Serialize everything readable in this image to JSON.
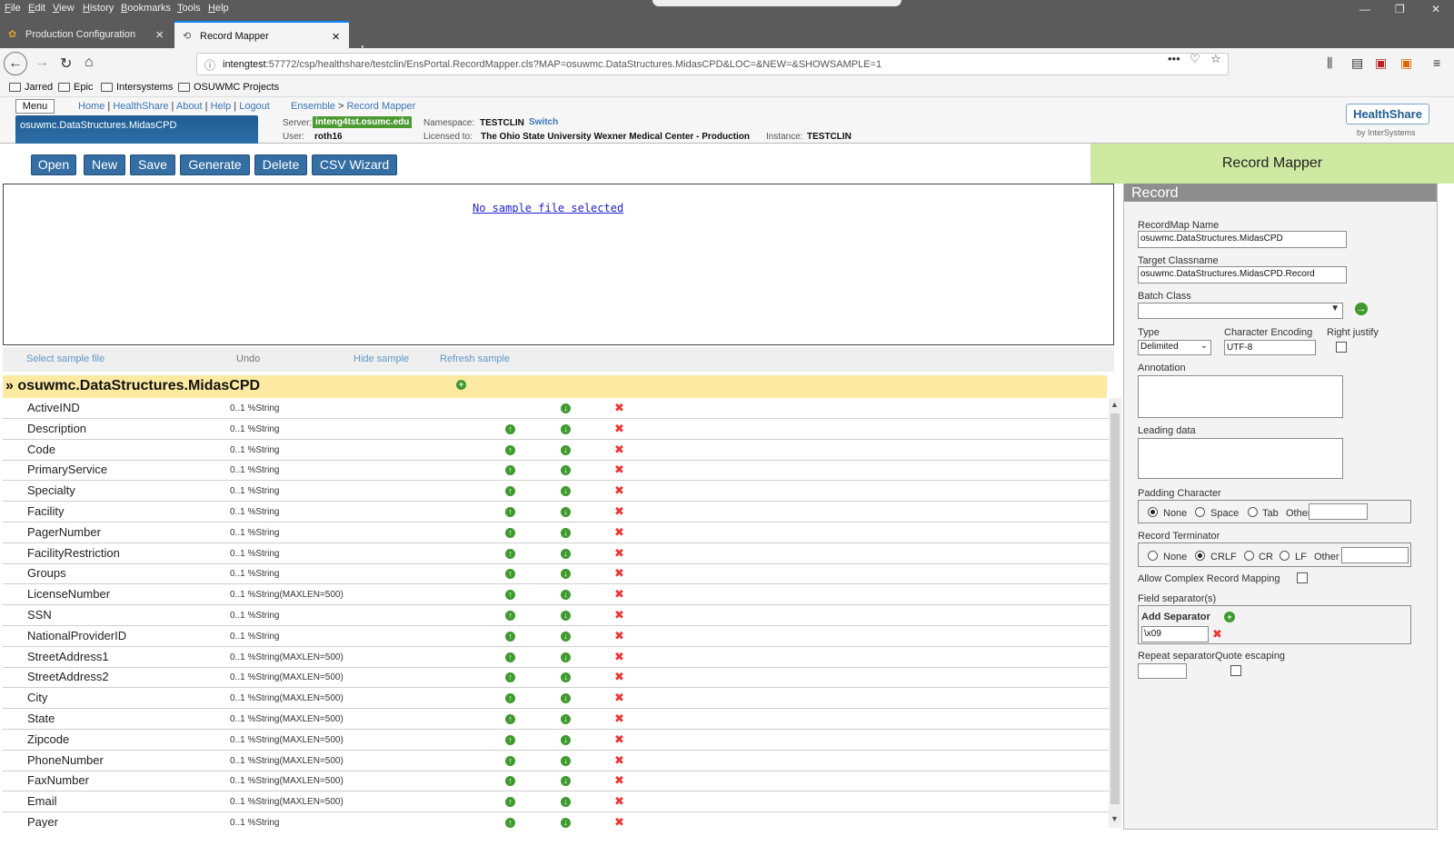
{
  "browser": {
    "menu": [
      "File",
      "Edit",
      "View",
      "History",
      "Bookmarks",
      "Tools",
      "Help"
    ],
    "tabs": [
      {
        "label": "Production Configuration"
      },
      {
        "label": "Record Mapper"
      }
    ],
    "url_host": "intengtest",
    "url_rest": ":57772/csp/healthshare/testclin/EnsPortal.RecordMapper.cls?MAP=osuwmc.DataStructures.MidasCPD&LOC=&NEW=&SHOWSAMPLE=1",
    "bookmarks": [
      "Jarred",
      "Epic",
      "Intersystems",
      "OSUWMC Projects"
    ]
  },
  "header": {
    "menu_label": "Menu",
    "links": [
      "Home",
      "HealthShare",
      "About",
      "Help",
      "Logout"
    ],
    "crumbs": [
      "Ensemble",
      "Record Mapper"
    ],
    "class_tab": "osuwmc.DataStructures.MidasCPD",
    "server_label": "Server:",
    "server": "inteng4tst.osumc.edu",
    "namespace_label": "Namespace:",
    "namespace": "TESTCLIN",
    "switch": "Switch",
    "user_label": "User:",
    "user": "roth16",
    "licensed_label": "Licensed to:",
    "licensed": "The Ohio State University Wexner Medical Center - Production",
    "instance_label": "Instance:",
    "instance": "TESTCLIN",
    "logo": "HealthShare",
    "logo_by": "by InterSystems"
  },
  "toolbar": {
    "buttons": [
      "Open",
      "New",
      "Save",
      "Generate",
      "Delete",
      "CSV Wizard"
    ],
    "title": "Record Mapper"
  },
  "sample": {
    "message": "No sample file selected",
    "actions": {
      "select": "Select sample file",
      "undo": "Undo",
      "hide": "Hide sample",
      "refresh": "Refresh sample"
    }
  },
  "record": {
    "name": "» osuwmc.DataStructures.MidasCPD",
    "fields": [
      {
        "name": "ActiveIND",
        "type": "0..1 %String"
      },
      {
        "name": "Description",
        "type": "0..1 %String"
      },
      {
        "name": "Code",
        "type": "0..1 %String"
      },
      {
        "name": "PrimaryService",
        "type": "0..1 %String"
      },
      {
        "name": "Specialty",
        "type": "0..1 %String"
      },
      {
        "name": "Facility",
        "type": "0..1 %String"
      },
      {
        "name": "PagerNumber",
        "type": "0..1 %String"
      },
      {
        "name": "FacilityRestriction",
        "type": "0..1 %String"
      },
      {
        "name": "Groups",
        "type": "0..1 %String"
      },
      {
        "name": "LicenseNumber",
        "type": "0..1 %String(MAXLEN=500)"
      },
      {
        "name": "SSN",
        "type": "0..1 %String"
      },
      {
        "name": "NationalProviderID",
        "type": "0..1 %String"
      },
      {
        "name": "StreetAddress1",
        "type": "0..1 %String(MAXLEN=500)"
      },
      {
        "name": "StreetAddress2",
        "type": "0..1 %String(MAXLEN=500)"
      },
      {
        "name": "City",
        "type": "0..1 %String(MAXLEN=500)"
      },
      {
        "name": "State",
        "type": "0..1 %String(MAXLEN=500)"
      },
      {
        "name": "Zipcode",
        "type": "0..1 %String(MAXLEN=500)"
      },
      {
        "name": "PhoneNumber",
        "type": "0..1 %String(MAXLEN=500)"
      },
      {
        "name": "FaxNumber",
        "type": "0..1 %String(MAXLEN=500)"
      },
      {
        "name": "Email",
        "type": "0..1 %String(MAXLEN=500)"
      },
      {
        "name": "Payer",
        "type": "0..1 %String"
      }
    ]
  },
  "panel": {
    "title": "Record",
    "recordmap_name_label": "RecordMap Name",
    "recordmap_name": "osuwmc.DataStructures.MidasCPD",
    "target_classname_label": "Target Classname",
    "target_classname": "osuwmc.DataStructures.MidasCPD.Record",
    "batch_class_label": "Batch Class",
    "type_label": "Type",
    "type_value": "Delimited",
    "encoding_label": "Character Encoding",
    "encoding_value": "UTF-8",
    "right_justify_label": "Right justify",
    "annotation_label": "Annotation",
    "leading_data_label": "Leading data",
    "padding_label": "Padding Character",
    "padding_options": [
      "None",
      "Space",
      "Tab",
      "Other"
    ],
    "terminator_label": "Record Terminator",
    "terminator_options": [
      "None",
      "CRLF",
      "CR",
      "LF",
      "Other"
    ],
    "complex_label": "Allow Complex Record Mapping",
    "field_sep_label": "Field separator(s)",
    "add_separator_label": "Add Separator",
    "separator_value": "\\x09",
    "repeat_sep_label": "Repeat separator",
    "quote_escaping_label": "Quote escaping"
  }
}
